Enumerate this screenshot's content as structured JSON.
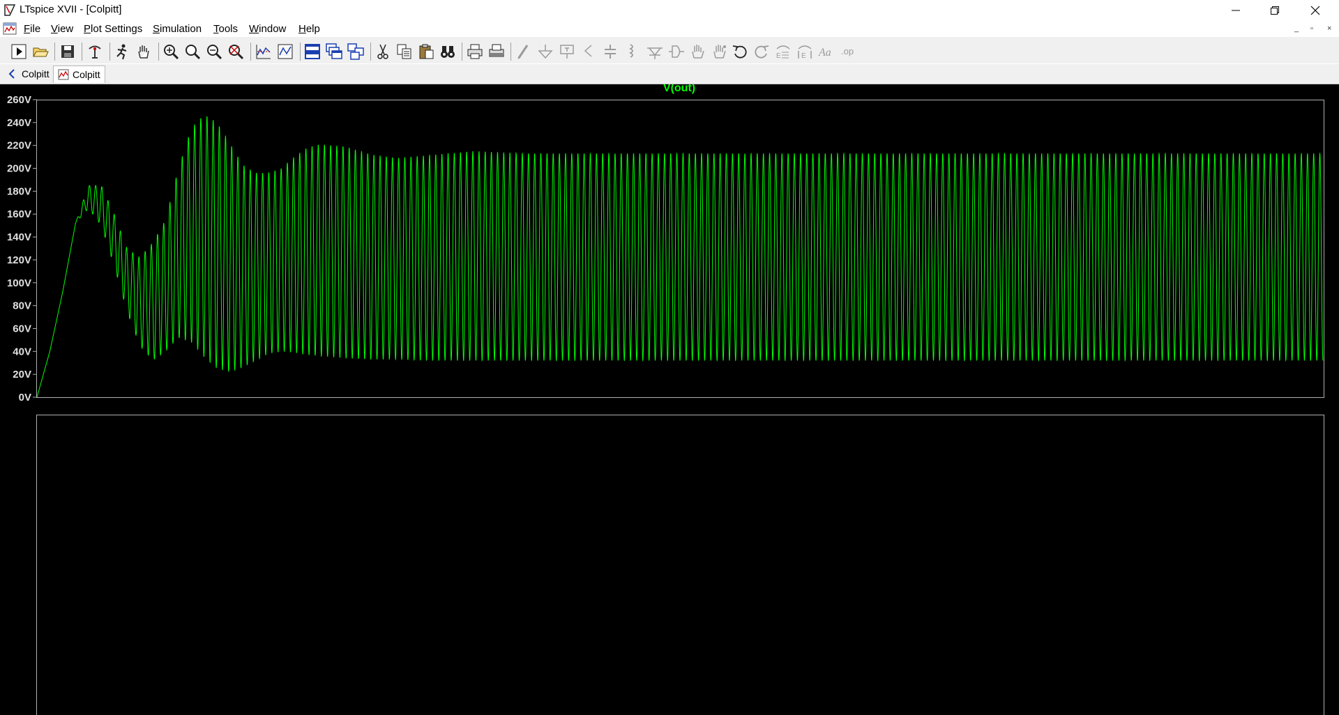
{
  "window": {
    "title": "LTspice XVII - [Colpitt]",
    "controls": [
      "minimize-icon",
      "restore-icon",
      "close-icon"
    ]
  },
  "menu": {
    "items": [
      {
        "first": "F",
        "rest": "ile"
      },
      {
        "first": "V",
        "rest": "iew"
      },
      {
        "first": "P",
        "rest": "lot Settings"
      },
      {
        "first": "S",
        "rest": "imulation"
      },
      {
        "first": "T",
        "rest": "ools"
      },
      {
        "first": "W",
        "rest": "indow"
      },
      {
        "first": "H",
        "rest": "elp"
      }
    ],
    "mdi_controls": [
      "_",
      "▫",
      "×"
    ]
  },
  "toolbar": {
    "icons": [
      "run-icon",
      "open-icon",
      "save-icon",
      "control-panel-icon",
      "halt-icon",
      "pan-hand-icon",
      "zoom-in-icon",
      "zoom-rect-icon",
      "zoom-out-icon",
      "zoom-fit-icon",
      "autoscale-icon",
      "plot-settings-icon",
      "tile-horizontal-icon",
      "cascade-icon",
      "tile-vertical-icon",
      "cut-icon",
      "copy-icon",
      "paste-icon",
      "find-icon",
      "print-icon",
      "print-preview-icon",
      "wire-icon",
      "ground-icon",
      "label-net-icon",
      "resistor-icon",
      "capacitor-icon",
      "inductor-icon",
      "diode-icon",
      "component-icon",
      "move-icon",
      "drag-icon",
      "undo-icon",
      "redo-icon",
      "rotate-icon",
      "mirror-icon",
      "text-icon",
      "spice-directive-icon"
    ]
  },
  "tabs": [
    {
      "label": "Colpitt",
      "icon": "schematic-icon",
      "active": false
    },
    {
      "label": "Colpitt",
      "icon": "waveform-icon",
      "active": true
    }
  ],
  "chart_data": {
    "type": "line",
    "title": "V(out)",
    "xlabel": "",
    "ylabel": "",
    "ylim": [
      0,
      260
    ],
    "y_ticks": [
      "260V",
      "240V",
      "220V",
      "200V",
      "180V",
      "160V",
      "140V",
      "120V",
      "100V",
      "80V",
      "60V",
      "40V",
      "20V",
      "0V"
    ],
    "x_ticks": [],
    "grid": false,
    "series": [
      {
        "name": "V(out)",
        "color": "#00ff00",
        "envelope": {
          "x": [
            0,
            0.01,
            0.02,
            0.03,
            0.04,
            0.05,
            0.06,
            0.07,
            0.08,
            0.09,
            0.1,
            0.11,
            0.12,
            0.13,
            0.14,
            0.15,
            0.16,
            0.17,
            0.18,
            0.19,
            0.2,
            0.21,
            0.22,
            0.24,
            0.26,
            0.28,
            0.3,
            0.32,
            0.34,
            0.36,
            0.38,
            0.4,
            0.45,
            0.5,
            0.6,
            0.7,
            0.8,
            0.9,
            1.0
          ],
          "max": [
            0,
            40,
            92,
            152,
            185,
            185,
            160,
            130,
            122,
            135,
            155,
            200,
            235,
            247,
            240,
            222,
            203,
            196,
            196,
            200,
            210,
            218,
            221,
            219,
            212,
            209,
            211,
            213,
            215,
            214,
            213,
            213,
            213,
            213,
            213,
            213,
            213,
            213,
            213
          ],
          "min": [
            0,
            40,
            92,
            152,
            165,
            150,
            115,
            75,
            45,
            32,
            40,
            52,
            48,
            35,
            25,
            22,
            26,
            32,
            38,
            40,
            39,
            37,
            36,
            34,
            33,
            33,
            32,
            32,
            32,
            32,
            32,
            32,
            32,
            32,
            32,
            32,
            32,
            32,
            32
          ]
        },
        "cycles_over_span": 208
      }
    ],
    "legend": "title-top-center"
  }
}
